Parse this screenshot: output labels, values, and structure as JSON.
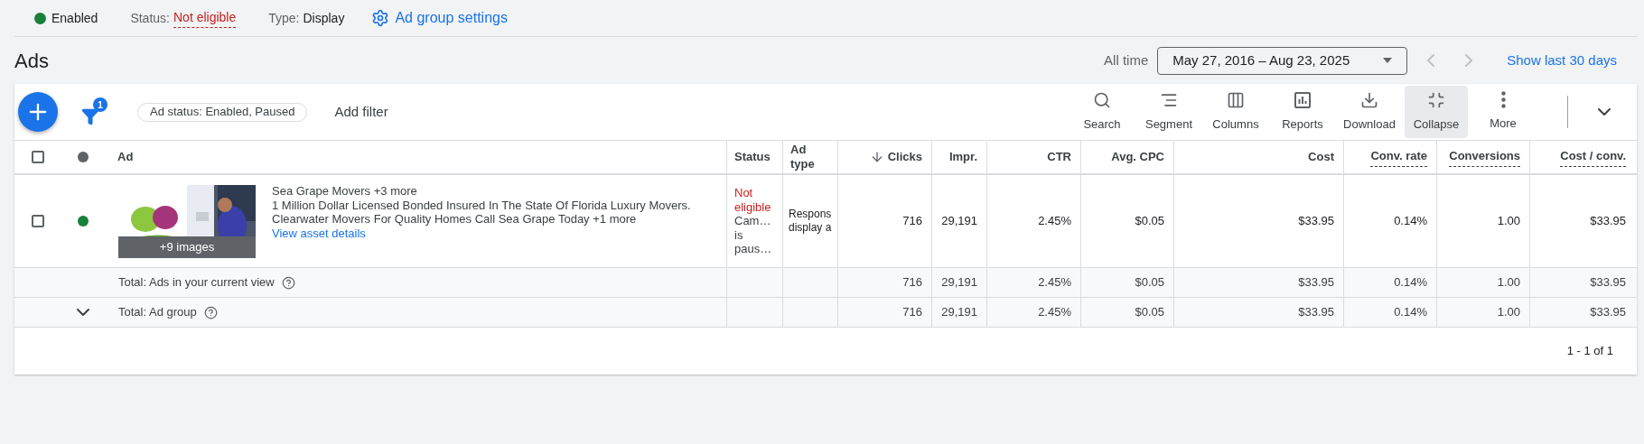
{
  "header": {
    "status_chip": {
      "label": "Enabled",
      "color": "#188038"
    },
    "status": {
      "label": "Status:",
      "value": "Not eligible"
    },
    "type": {
      "label": "Type:",
      "value": "Display"
    },
    "settings_link": "Ad group settings"
  },
  "page_title": "Ads",
  "date_range": {
    "label": "All time",
    "value": "May 27, 2016 – Aug 23, 2025",
    "show_last": "Show last 30 days"
  },
  "toolbar": {
    "filter_count": "1",
    "filter_chip": "Ad status: Enabled, Paused",
    "add_filter": "Add filter",
    "tools": [
      {
        "kind": "search",
        "label": "Search",
        "selected": false
      },
      {
        "kind": "segment",
        "label": "Segment",
        "selected": false
      },
      {
        "kind": "columns",
        "label": "Columns",
        "selected": false
      },
      {
        "kind": "reports",
        "label": "Reports",
        "selected": false
      },
      {
        "kind": "download",
        "label": "Download",
        "selected": false
      },
      {
        "kind": "collapse",
        "label": "Collapse",
        "selected": true
      },
      {
        "kind": "more",
        "label": "More",
        "selected": false
      }
    ]
  },
  "table": {
    "header_checked": false,
    "columns": [
      {
        "label": "Ad"
      },
      {
        "label": "Status"
      },
      {
        "label": "Ad type"
      },
      {
        "label": "Clicks",
        "sorted": true,
        "dashed": false
      },
      {
        "label": "Impr.",
        "sorted": false,
        "dashed": false
      },
      {
        "label": "CTR",
        "sorted": false,
        "dashed": false
      },
      {
        "label": "Avg. CPC",
        "sorted": false,
        "dashed": false
      },
      {
        "label": "Cost",
        "sorted": false,
        "dashed": false
      },
      {
        "label": "Conv. rate",
        "sorted": false,
        "dashed": true
      },
      {
        "label": "Conversions",
        "sorted": false,
        "dashed": true
      },
      {
        "label": "Cost / conv.",
        "sorted": false,
        "dashed": true
      }
    ],
    "rows": [
      {
        "checked": false,
        "image_badge": "+9 images",
        "headline": "Sea Grape Movers +3 more",
        "descriptions": [
          "1 Million Dollar Licensed Bonded Insured In The State Of Florida Luxury Movers.",
          "Clearwater Movers For Quality Homes Call Sea Grape Today +1 more"
        ],
        "link": "View asset details",
        "status": "Not eligible",
        "status_detail": [
          "Cam…",
          "is",
          "paus…"
        ],
        "ad_type": [
          "Respons",
          "display a"
        ],
        "values": [
          "716",
          "29,191",
          "2.45%",
          "$0.05",
          "$33.95",
          "0.14%",
          "1.00",
          "$33.95"
        ]
      }
    ],
    "totals": [
      {
        "label": "Total: Ads in your current view",
        "values": [
          "716",
          "29,191",
          "2.45%",
          "$0.05",
          "$33.95",
          "0.14%",
          "1.00",
          "$33.95"
        ]
      },
      {
        "label": "Total: Ad group",
        "expanded": false,
        "values": [
          "716",
          "29,191",
          "2.45%",
          "$0.05",
          "$33.95",
          "0.14%",
          "1.00",
          "$33.95"
        ]
      }
    ]
  },
  "pagination": "1 - 1 of 1"
}
